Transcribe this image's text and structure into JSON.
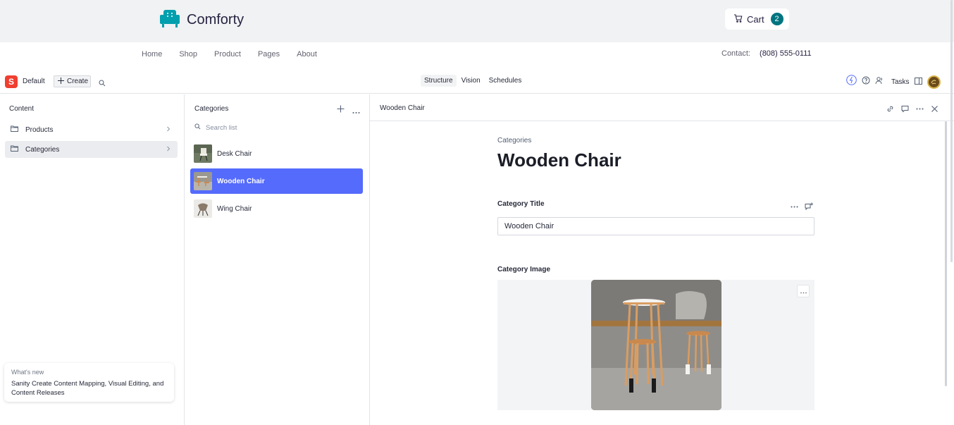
{
  "store": {
    "brand": "Comforty",
    "cart_label": "Cart",
    "cart_count": "2",
    "nav": [
      "Home",
      "Shop",
      "Product",
      "Pages",
      "About"
    ],
    "contact_label": "Contact:",
    "contact_phone": "(808) 555-0111"
  },
  "studio": {
    "workspace": "Default",
    "create_label": "Create",
    "tools": [
      "Structure",
      "Vision",
      "Schedules"
    ],
    "active_tool": "Structure",
    "tasks_label": "Tasks"
  },
  "content_pane": {
    "title": "Content",
    "items": [
      {
        "label": "Products"
      },
      {
        "label": "Categories"
      }
    ],
    "selected": "Categories"
  },
  "whats_new": {
    "title": "What's new",
    "body": "Sanity Create Content Mapping, Visual Editing, and Content Releases"
  },
  "list_pane": {
    "title": "Categories",
    "search_placeholder": "Search list",
    "items": [
      {
        "label": "Desk Chair"
      },
      {
        "label": "Wooden Chair"
      },
      {
        "label": "Wing Chair"
      }
    ],
    "selected": "Wooden Chair"
  },
  "document": {
    "header_title": "Wooden Chair",
    "breadcrumb": "Categories",
    "title": "Wooden Chair",
    "fields": {
      "title_label": "Category Title",
      "title_value": "Wooden Chair",
      "image_label": "Category Image"
    }
  },
  "colors": {
    "brand_teal": "#029fae",
    "badge": "#007580",
    "selection": "#556bfc",
    "sanity_red": "#f03e2f"
  },
  "icons": [
    "armchair-logo-icon",
    "cart-icon",
    "sanity-logo-icon",
    "plus-icon",
    "search-icon",
    "folder-icon",
    "chevron-right-icon",
    "more-icon",
    "link-icon",
    "comment-icon",
    "close-icon",
    "bolt-icon",
    "help-icon",
    "people-icon",
    "panel-icon"
  ]
}
